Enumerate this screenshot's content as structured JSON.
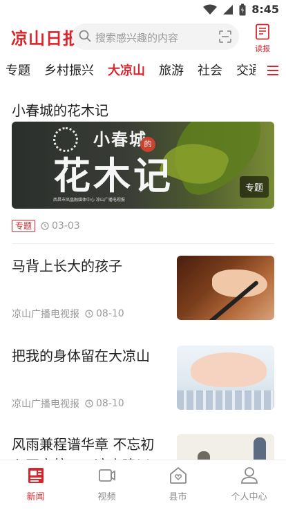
{
  "status_bar": {
    "time": "8:45"
  },
  "header": {
    "logo_text": "凉山日报",
    "search_placeholder": "搜索感兴趣的内容",
    "read_label": "读报"
  },
  "tabs": {
    "items": [
      "专题",
      "乡村振兴",
      "大凉山",
      "旅游",
      "社会",
      "交通"
    ],
    "active_index": 2
  },
  "featured": {
    "title": "小春城的花木记",
    "image_line1": "小春城",
    "image_small": "的",
    "image_line2": "花木记",
    "image_footer": "西昌市凤凰融媒体中心 凉山广播电视报",
    "badge": "专题",
    "tag": "专题",
    "date": "03-03"
  },
  "news": [
    {
      "title": "马背上长大的孩子",
      "source": "凉山广播电视报",
      "date": "08-10"
    },
    {
      "title": "把我的身体留在大凉山",
      "source": "凉山广播电视报",
      "date": "08-10"
    },
    {
      "title": "风雨兼程谱华章 不忘初心再启航——凉山建川"
    }
  ],
  "bottom_nav": {
    "items": [
      "新闻",
      "视频",
      "县市",
      "个人中心"
    ],
    "active_index": 0
  },
  "colors": {
    "accent": "#d8262c",
    "muted": "#999999"
  }
}
